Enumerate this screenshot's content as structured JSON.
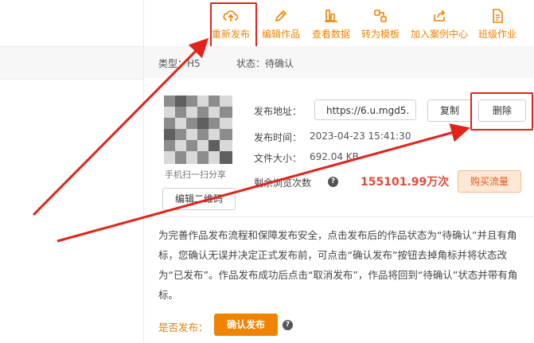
{
  "toolbar": {
    "items": [
      {
        "label": "重新发布",
        "icon": "cloud-upload-icon"
      },
      {
        "label": "编辑作品",
        "icon": "pencil-icon"
      },
      {
        "label": "查看数据",
        "icon": "bar-chart-icon"
      },
      {
        "label": "转为模板",
        "icon": "template-icon"
      },
      {
        "label": "加入案例中心",
        "icon": "share-icon"
      },
      {
        "label": "班级作业",
        "icon": "document-icon"
      }
    ]
  },
  "meta": {
    "type_label": "类型：H5",
    "status_label": "状态：待确认"
  },
  "publish": {
    "url_label": "发布地址：",
    "url_value": "https://6.u.mgd5.",
    "copy_label": "复制",
    "delete_label": "删除",
    "time_label": "发布时间：",
    "time_value": "2023-04-23 15:41:30",
    "size_label": "文件大小：",
    "size_value": "692.04 KB",
    "views_label": "剩余浏览次数",
    "views_value": "155101.99万次",
    "buy_label": "购买流量",
    "qr_caption": "手机扫一扫分享",
    "edit_qr_label": "编辑二维码"
  },
  "notice": "为完善作品发布流程和保障发布安全，点击发布后的作品状态为“待确认”并且有角标，您确认无误并决定正式发布前，可点击“确认发布”按钮去掉角标并将状态改为“已发布”。作品发布成功后点击“取消发布”，作品将回到“待确认”状态并带有角标。",
  "confirm": {
    "question": "是否发布：",
    "button": "确认发布"
  },
  "colors": {
    "accent": "#f08300",
    "highlight": "#e2231a",
    "views": "#e24a3b"
  }
}
